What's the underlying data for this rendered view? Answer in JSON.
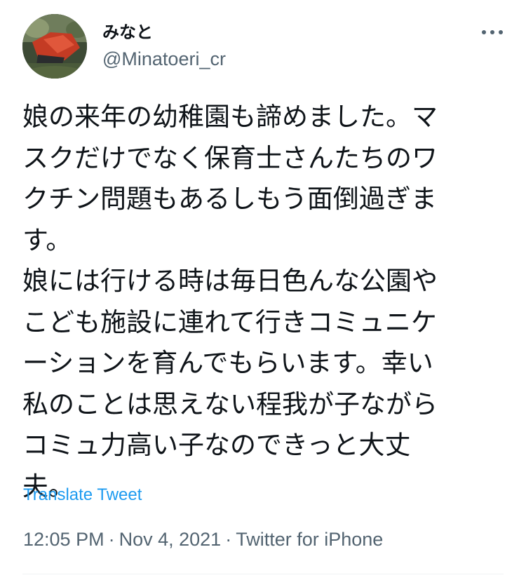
{
  "author": {
    "display_name": "みなと",
    "handle": "@Minatoeri_cr",
    "avatar_icon": "avatar-photo"
  },
  "more_icon": "more-horizontal-icon",
  "tweet": {
    "lines": [
      "娘の来年の幼稚園も諦めました。マ",
      "スクだけでなく保育士さんたちのワ",
      "クチン問題もあるしもう面倒過ぎま",
      "す。",
      "娘には行ける時は毎日色んな公園や",
      "こども施設に連れて行きコミュニケ",
      "ーションを育んでもらいます。幸い",
      "私のことは思えない程我が子ながら",
      "コミュ力高い子なのできっと大丈",
      "夫。"
    ]
  },
  "translate_label": "Translate Tweet",
  "meta": {
    "time": "12:05 PM",
    "separator": "·",
    "date": "Nov 4, 2021",
    "source": "Twitter for iPhone"
  },
  "colors": {
    "accent": "#1d9bf0",
    "secondary_text": "#536471",
    "primary_text": "#0f1419"
  }
}
